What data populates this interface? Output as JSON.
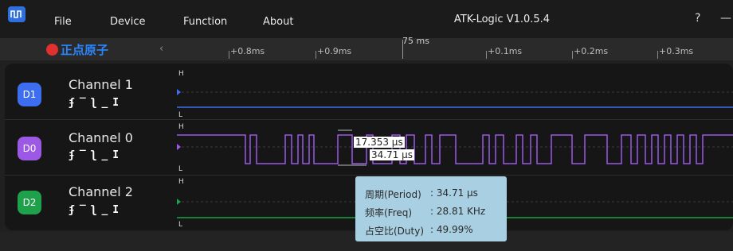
{
  "menu": {
    "file": "File",
    "device": "Device",
    "function": "Function",
    "about": "About"
  },
  "app_title": "ATK-Logic  V1.0.5.4",
  "window_buttons": {
    "help": "?",
    "minimize": "—"
  },
  "brand": {
    "name": "正点原子",
    "icon": "atk-logo-icon"
  },
  "ruler": {
    "collapse_icon": "chevron-left-icon",
    "center_label": "75 ms",
    "ticks": [
      "+0.8ms",
      "+0.9ms",
      "+0.1ms",
      "+0.2ms",
      "+0.3ms"
    ]
  },
  "channels": [
    {
      "badge": "D1",
      "name": "Channel 1",
      "color": "#3d6ef0",
      "trigger_icons": "rising-edge-icon high-level-icon falling-edge-icon low-level-icon any-edge-icon"
    },
    {
      "badge": "D0",
      "name": "Channel 0",
      "color": "#9b59e6",
      "trigger_icons": "rising-edge-icon high-level-icon falling-edge-icon low-level-icon any-edge-icon"
    },
    {
      "badge": "D2",
      "name": "Channel 2",
      "color": "#1fa04a",
      "trigger_icons": "rising-edge-icon high-level-icon falling-edge-icon low-level-icon any-edge-icon"
    }
  ],
  "levels": {
    "high": "H",
    "low": "L"
  },
  "measure": {
    "pulse_width": "17.353 μs",
    "period": "34.71 μs"
  },
  "tooltip": {
    "period_label": "周期(Period)",
    "period_value": ":  34.71 μs",
    "freq_label": "频率(Freq)",
    "freq_value": ":  28.81 KHz",
    "duty_label": "占空比(Duty)",
    "duty_value": ":  49.99%"
  }
}
